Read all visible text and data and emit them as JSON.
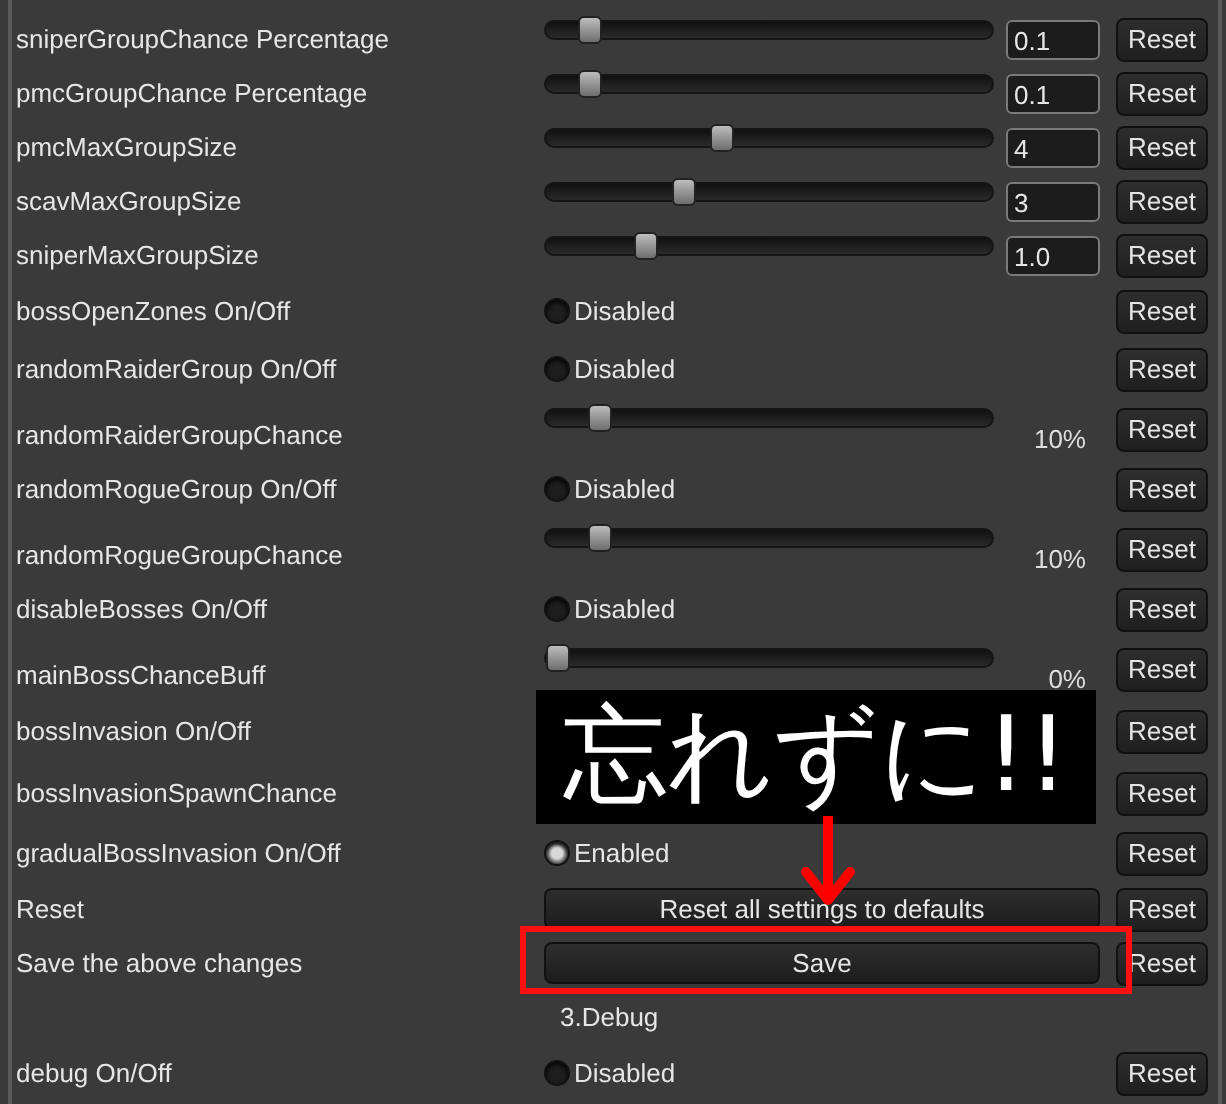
{
  "settings": [
    {
      "label": "sniperGroupChance Percentage",
      "kind": "slider_value",
      "level": 0.075,
      "value": "0.1",
      "reset": "Reset"
    },
    {
      "label": "pmcGroupChance Percentage",
      "kind": "slider_value",
      "level": 0.075,
      "value": "0.1",
      "reset": "Reset"
    },
    {
      "label": "pmcMaxGroupSize",
      "kind": "slider_value",
      "level": 0.39,
      "value": "4",
      "reset": "Reset"
    },
    {
      "label": "scavMaxGroupSize",
      "kind": "slider_value",
      "level": 0.3,
      "value": "3",
      "reset": "Reset"
    },
    {
      "label": "sniperMaxGroupSize",
      "kind": "slider_value",
      "level": 0.21,
      "value": "1.0",
      "reset": "Reset"
    },
    {
      "label": "bossOpenZones On/Off",
      "kind": "toggle",
      "on": false,
      "state_text": "Disabled",
      "reset": "Reset"
    },
    {
      "label": "randomRaiderGroup On/Off",
      "kind": "toggle",
      "on": false,
      "state_text": "Disabled",
      "reset": "Reset"
    },
    {
      "label": "randomRaiderGroupChance",
      "kind": "slider_percent",
      "level": 0.1,
      "reading": "10%",
      "reset": "Reset"
    },
    {
      "label": "randomRogueGroup On/Off",
      "kind": "toggle",
      "on": false,
      "state_text": "Disabled",
      "reset": "Reset"
    },
    {
      "label": "randomRogueGroupChance",
      "kind": "slider_percent",
      "level": 0.1,
      "reading": "10%",
      "reset": "Reset"
    },
    {
      "label": "disableBosses On/Off",
      "kind": "toggle",
      "on": false,
      "state_text": "Disabled",
      "reset": "Reset"
    },
    {
      "label": "mainBossChanceBuff",
      "kind": "slider_percent",
      "level": 0,
      "reading": "0%",
      "reset": "Reset"
    },
    {
      "label": "bossInvasion On/Off",
      "kind": "covered",
      "reset": "Reset"
    },
    {
      "label": "bossInvasionSpawnChance",
      "kind": "covered",
      "reset": "Reset"
    },
    {
      "label": "gradualBossInvasion On/Off",
      "kind": "toggle",
      "on": true,
      "state_text": "Enabled",
      "reset": "Reset"
    },
    {
      "label": "Reset",
      "kind": "button",
      "button": "Reset all settings to defaults",
      "reset": "Reset"
    },
    {
      "label": "Save the above changes",
      "kind": "button",
      "button": "Save",
      "highlighted": true,
      "reset": "Reset"
    },
    {
      "kind": "heading",
      "text": "3.Debug"
    },
    {
      "label": "debug On/Off",
      "kind": "toggle",
      "on": false,
      "state_text": "Disabled",
      "reset": "Reset"
    }
  ],
  "annotation": {
    "text": "忘れずに!!"
  }
}
